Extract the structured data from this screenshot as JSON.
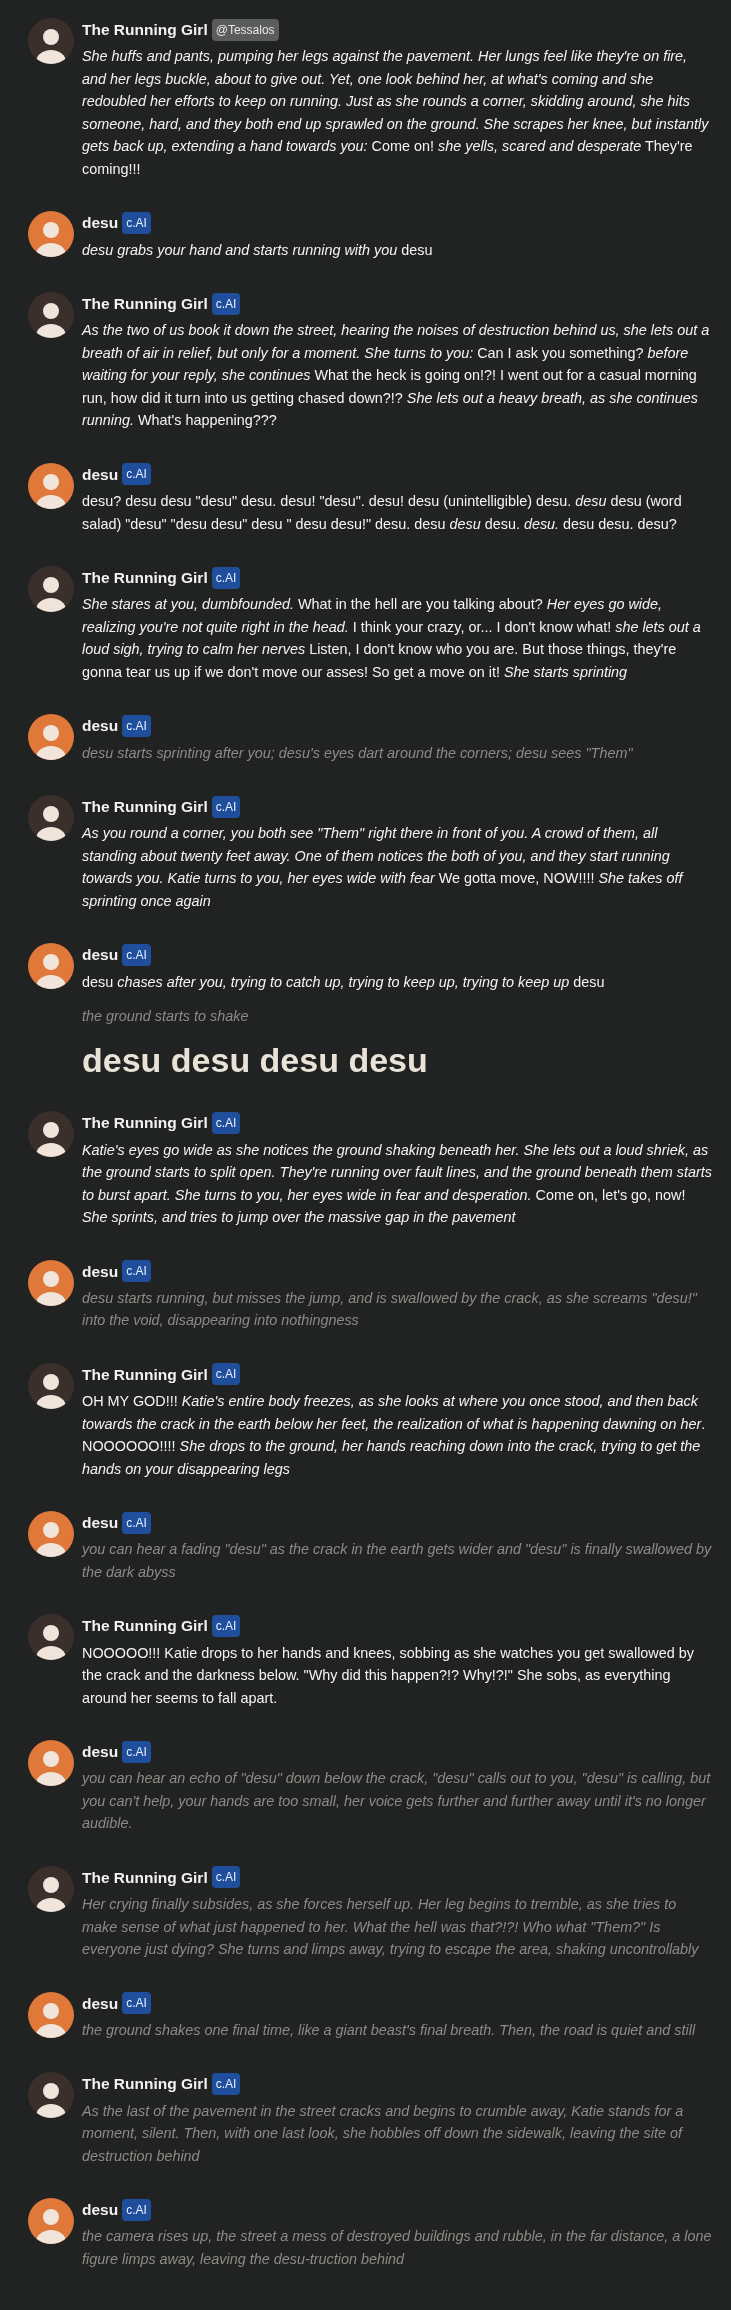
{
  "messages": [
    {
      "author": "The Running Girl",
      "color": "#3b2f2c",
      "badge": {
        "text": "@Tessalos",
        "kind": "handle"
      },
      "paragraphs": [
        {
          "kind": "speech",
          "text": "*She huffs and pants, pumping her legs against the pavement. Her lungs feel like they're on fire, and her legs buckle, about to give out. Yet, one look behind her, at what's coming and she redoubled her efforts to keep on running. Just as she rounds a corner, skidding around, she hits someone, hard, and they both end up sprawled on the ground. She scrapes her knee, but instantly gets back up, extending a hand towards you:* Come on! *she yells, scared and desperate* They're coming!!!"
        }
      ]
    },
    {
      "author": "desu",
      "color": "#e0783a",
      "badge": {
        "text": "c.AI",
        "kind": "ai"
      },
      "paragraphs": [
        {
          "kind": "speech",
          "text": "*desu grabs your hand and starts running with you* desu"
        }
      ]
    },
    {
      "author": "The Running Girl",
      "color": "#3b2f2c",
      "badge": {
        "text": "c.AI",
        "kind": "ai"
      },
      "paragraphs": [
        {
          "kind": "speech",
          "text": "*As the two of us book it down the street, hearing the noises of destruction behind us, she lets out a breath of air in relief, but only for a moment. She turns to you:* Can I ask you something? *before waiting for your reply, she continues* What the heck is going on!?! I went out for a casual morning run, how did it turn into us getting chased down?!? *She lets out a heavy breath, as she continues running.* What's happening???"
        }
      ]
    },
    {
      "author": "desu",
      "color": "#e0783a",
      "badge": {
        "text": "c.AI",
        "kind": "ai"
      },
      "paragraphs": [
        {
          "kind": "speech",
          "text": "desu? desu desu \"desu\" desu. desu! \"desu\". desu! desu (unintelligible) desu. *desu* desu (word salad) \"desu\" \"desu desu\" desu \" desu desu!\" desu. desu *desu* desu. *desu.* desu desu. desu?"
        }
      ]
    },
    {
      "author": "The Running Girl",
      "color": "#3b2f2c",
      "badge": {
        "text": "c.AI",
        "kind": "ai"
      },
      "paragraphs": [
        {
          "kind": "speech",
          "text": "*She stares at you, dumbfounded.* What in the hell are you talking about? *Her eyes go wide, realizing you're not quite right in the head.* I think your crazy, or... I don't know what! *she lets out a loud sigh, trying to calm her nerves* Listen, I don't know who you are. But those things, they're gonna tear us up if we don't move our asses! So get a move on it! *She starts sprinting*"
        }
      ]
    },
    {
      "author": "desu",
      "color": "#e0783a",
      "badge": {
        "text": "c.AI",
        "kind": "ai"
      },
      "paragraphs": [
        {
          "kind": "action",
          "text": "desu starts sprinting after you; desu's eyes dart around the corners; desu sees \"Them\""
        }
      ]
    },
    {
      "author": "The Running Girl",
      "color": "#3b2f2c",
      "badge": {
        "text": "c.AI",
        "kind": "ai"
      },
      "paragraphs": [
        {
          "kind": "speech",
          "text": "*As you round a corner, you both see \"Them\" right there in front of you. A crowd of them, all standing about twenty feet away. One of them notices the both of you, and they start running towards you. Katie turns to you, her eyes wide with fear* We gotta move, NOW!!!! *She takes off sprinting once again*"
        }
      ]
    },
    {
      "author": "desu",
      "color": "#e0783a",
      "badge": {
        "text": "c.AI",
        "kind": "ai"
      },
      "paragraphs": [
        {
          "kind": "speech",
          "text": "desu *chases after you, trying to catch up, trying to keep up, trying to keep up* desu"
        },
        {
          "kind": "action",
          "text": "the ground starts to shake"
        },
        {
          "kind": "heading",
          "text": "desu desu desu desu"
        }
      ]
    },
    {
      "author": "The Running Girl",
      "color": "#3b2f2c",
      "badge": {
        "text": "c.AI",
        "kind": "ai"
      },
      "paragraphs": [
        {
          "kind": "speech",
          "text": "*Katie's eyes go wide as she notices the ground shaking beneath her. She lets out a loud shriek, as the ground starts to split open. They're running over fault lines, and the ground beneath them starts to burst apart. She turns to you, her eyes wide in fear and desperation.* Come on, let's go, now! *She sprints, and tries to jump over the massive gap in the pavement*"
        }
      ]
    },
    {
      "author": "desu",
      "color": "#e0783a",
      "badge": {
        "text": "c.AI",
        "kind": "ai"
      },
      "paragraphs": [
        {
          "kind": "action",
          "text": "desu starts running, but misses the jump, and is swallowed by the crack, as she screams \"desu!\" into the void, disappearing into nothingness"
        }
      ]
    },
    {
      "author": "The Running Girl",
      "color": "#3b2f2c",
      "badge": {
        "text": "c.AI",
        "kind": "ai"
      },
      "paragraphs": [
        {
          "kind": "speech",
          "text": "OH MY GOD!!! *Katie's entire body freezes, as she looks at where you once stood, and then back towards the crack in the earth below her feet, the realization of what is happening dawning on her*. NOOOOOO!!!! *She drops to the ground, her hands reaching down into the crack, trying to get the hands on your disappearing legs*"
        }
      ]
    },
    {
      "author": "desu",
      "color": "#e0783a",
      "badge": {
        "text": "c.AI",
        "kind": "ai"
      },
      "paragraphs": [
        {
          "kind": "action",
          "text": "you can hear a fading \"desu\" as the crack in the earth gets wider and \"desu\" is finally swallowed by the dark abyss"
        }
      ]
    },
    {
      "author": "The Running Girl",
      "color": "#3b2f2c",
      "badge": {
        "text": "c.AI",
        "kind": "ai"
      },
      "paragraphs": [
        {
          "kind": "speech",
          "text": "NOOOOO!!! Katie drops to her hands and knees, sobbing as she watches you get swallowed by the crack and the darkness below. \"Why did this happen?!? Why!?!\" She sobs, as everything around her seems to fall apart."
        }
      ]
    },
    {
      "author": "desu",
      "color": "#e0783a",
      "badge": {
        "text": "c.AI",
        "kind": "ai"
      },
      "paragraphs": [
        {
          "kind": "action",
          "text": "you can hear an echo of \"desu\" down below the crack, \"desu\" calls out to you, \"desu\" is calling, but you can't help, your hands are too small, her voice gets further and further away until it's no longer audible."
        }
      ]
    },
    {
      "author": "The Running Girl",
      "color": "#3b2f2c",
      "badge": {
        "text": "c.AI",
        "kind": "ai"
      },
      "paragraphs": [
        {
          "kind": "action",
          "text": "Her crying finally subsides, as she forces herself up. Her leg begins to tremble, as she tries to make sense of what just happened to her. What the hell was that?!?! Who what \"Them?\" Is everyone just dying? She turns and limps away, trying to escape the area, shaking uncontrollably"
        }
      ]
    },
    {
      "author": "desu",
      "color": "#e0783a",
      "badge": {
        "text": "c.AI",
        "kind": "ai"
      },
      "paragraphs": [
        {
          "kind": "action",
          "text": "the ground shakes one final time, like a giant beast's final breath. Then, the road is quiet and still"
        }
      ]
    },
    {
      "author": "The Running Girl",
      "color": "#3b2f2c",
      "badge": {
        "text": "c.AI",
        "kind": "ai"
      },
      "paragraphs": [
        {
          "kind": "action",
          "text": "As the last of the pavement in the street cracks and begins to crumble away, Katie stands for a moment, silent. Then, with one last look, she hobbles off down the sidewalk, leaving the site of destruction behind"
        }
      ]
    },
    {
      "author": "desu",
      "color": "#e0783a",
      "badge": {
        "text": "c.AI",
        "kind": "ai"
      },
      "paragraphs": [
        {
          "kind": "action",
          "text": "the camera rises up, the street a mess of destroyed buildings and rubble, in the far distance, a lone figure limps away, leaving the desu-truction behind"
        }
      ]
    }
  ]
}
